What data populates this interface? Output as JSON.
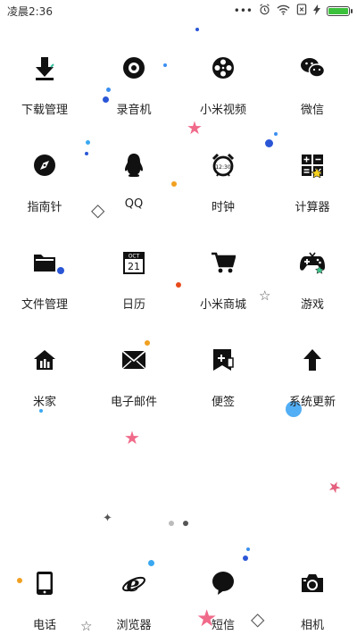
{
  "status": {
    "time": "凌晨2:36",
    "icons": [
      "more-dots-icon",
      "alarm-icon",
      "wifi-icon",
      "sim-icon",
      "charging-icon",
      "battery-icon"
    ],
    "battery_level": 1.0,
    "battery_color": "#3cc13c"
  },
  "apps": [
    {
      "label": "下载管理",
      "icon": "download-icon"
    },
    {
      "label": "录音机",
      "icon": "recorder-icon"
    },
    {
      "label": "小米视频",
      "icon": "video-reel-icon"
    },
    {
      "label": "微信",
      "icon": "wechat-icon"
    },
    {
      "label": "指南针",
      "icon": "compass-icon"
    },
    {
      "label": "QQ",
      "icon": "qq-penguin-icon"
    },
    {
      "label": "时钟",
      "icon": "alarm-clock-icon"
    },
    {
      "label": "计算器",
      "icon": "calculator-icon"
    },
    {
      "label": "文件管理",
      "icon": "folder-icon"
    },
    {
      "label": "日历",
      "icon": "calendar-icon",
      "month": "OCT",
      "day": "21"
    },
    {
      "label": "小米商城",
      "icon": "shopping-cart-icon"
    },
    {
      "label": "游戏",
      "icon": "gamepad-icon"
    },
    {
      "label": "米家",
      "icon": "smart-home-icon"
    },
    {
      "label": "电子邮件",
      "icon": "mail-icon"
    },
    {
      "label": "便签",
      "icon": "notes-icon"
    },
    {
      "label": "系统更新",
      "icon": "update-arrow-icon"
    }
  ],
  "pager": {
    "pages": 2,
    "active": 2
  },
  "dock": [
    {
      "label": "电话",
      "icon": "phone-icon"
    },
    {
      "label": "浏览器",
      "icon": "browser-icon"
    },
    {
      "label": "短信",
      "icon": "message-icon"
    },
    {
      "label": "相机",
      "icon": "camera-icon"
    }
  ],
  "colors": {
    "text": "#222222",
    "icon": "#111111",
    "background": "#ffffff"
  }
}
